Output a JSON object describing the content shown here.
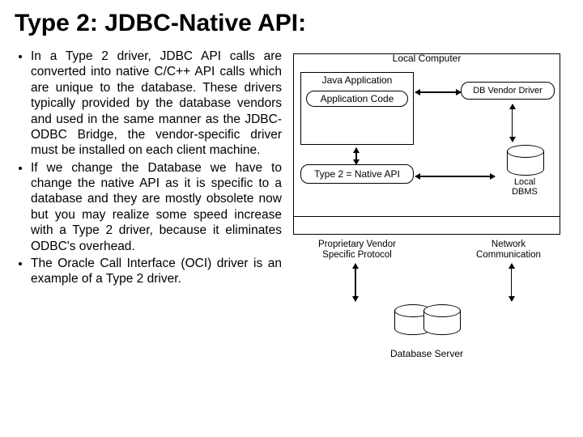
{
  "title": "Type 2: JDBC-Native API:",
  "bullets": [
    "In a Type 2 driver, JDBC API calls are converted into native C/C++ API calls which are unique to the database. These drivers typically provided by the database vendors and used in the same manner as the JDBC-ODBC Bridge, the vendor-specific driver must be installed on each client machine.",
    "If we change the Database we have to change the native API as it is specific to a database and they are mostly obsolete now but you may realize some speed increase with a Type 2 driver, because it eliminates ODBC's overhead.",
    "The Oracle Call Interface (OCI) driver is an example of a Type 2 driver."
  ],
  "diagram": {
    "local_computer": "Local Computer",
    "java_application": "Java Application",
    "application_code": "Application Code",
    "native_api": "Type 2 = Native API",
    "db_vendor_driver": "DB Vendor Driver",
    "local_dbms": "Local DBMS",
    "proprietary_vendor_protocol": "Proprietary Vendor Specific Protocol",
    "network_communication": "Network Communication",
    "database_server": "Database Server"
  }
}
